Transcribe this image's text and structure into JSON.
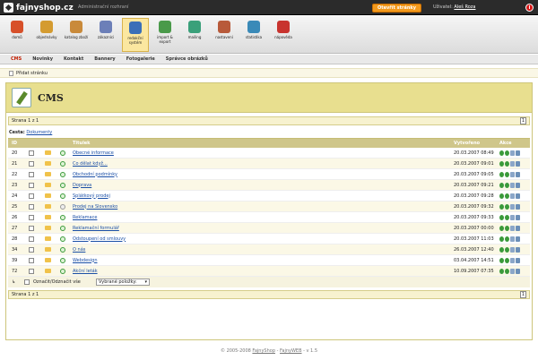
{
  "top": {
    "logo": "fajnyshop.cz",
    "admin_title": "Administrační rozhraní",
    "open_shop": "Otevřít stránky",
    "user_label": "Uživatel:",
    "user_name": "Aleš Roza"
  },
  "toolbar": [
    {
      "label": "domů",
      "color": "#d7502a"
    },
    {
      "label": "objednávky",
      "color": "#d49b30"
    },
    {
      "label": "katalog zboží",
      "color": "#c98a3a"
    },
    {
      "label": "zákazníci",
      "color": "#6c7fb8"
    },
    {
      "label": "redakční systém",
      "color": "#3a6fb8"
    },
    {
      "label": "import & export",
      "color": "#4a9a4a"
    },
    {
      "label": "mailing",
      "color": "#3aa07a"
    },
    {
      "label": "nastavení",
      "color": "#b85a3a"
    },
    {
      "label": "statistika",
      "color": "#3a8ab8"
    },
    {
      "label": "nápověda",
      "color": "#c8332e"
    }
  ],
  "subnav": [
    "CMS",
    "Novinky",
    "Kontakt",
    "Bannery",
    "Fotogalerie",
    "Správce obrázků"
  ],
  "action": {
    "add_page": "Přidat stránku"
  },
  "cms": {
    "title": "CMS"
  },
  "pager": {
    "text": "Strana 1 z 1",
    "page": "1"
  },
  "path": {
    "label": "Cesta:",
    "value": "Dokumenty"
  },
  "table": {
    "headers": {
      "id": "ID",
      "title": "Titulek",
      "created": "Vytvořeno",
      "actions": "Akce"
    },
    "rows": [
      {
        "id": "20",
        "title": "Obecné informace",
        "date": "20.03.2007 08:49"
      },
      {
        "id": "21",
        "title": "Co dělat když...",
        "date": "20.03.2007 09:01"
      },
      {
        "id": "22",
        "title": "Obchodní podmínky",
        "date": "20.03.2007 09:05"
      },
      {
        "id": "23",
        "title": "Doprava",
        "date": "20.03.2007 09:21"
      },
      {
        "id": "24",
        "title": "Splátkový prodej",
        "date": "20.03.2007 09:28"
      },
      {
        "id": "25",
        "title": "Prodej na Slovensko",
        "date": "20.03.2007 09:32"
      },
      {
        "id": "26",
        "title": "Reklamace",
        "date": "20.03.2007 09:33"
      },
      {
        "id": "27",
        "title": "Reklamační formulář",
        "date": "20.03.2007 00:00"
      },
      {
        "id": "28",
        "title": "Odstoupení od smlouvy",
        "date": "20.03.2007 11:03"
      },
      {
        "id": "34",
        "title": "O nás",
        "date": "26.03.2007 12:40"
      },
      {
        "id": "39",
        "title": "Webdesign",
        "date": "03.04.2007 14:51"
      },
      {
        "id": "72",
        "title": "Akční leták",
        "date": "10.09.2007 07:35"
      }
    ],
    "footer": {
      "select_all": "Označit/Odznačit vše",
      "selected": "Vybrané položky:"
    }
  },
  "footer": {
    "text": "© 2005-2008",
    "link1": "FajnyShop",
    "sep": " - ",
    "link2": "FajnyWEB",
    "version": " - v 1.5"
  }
}
